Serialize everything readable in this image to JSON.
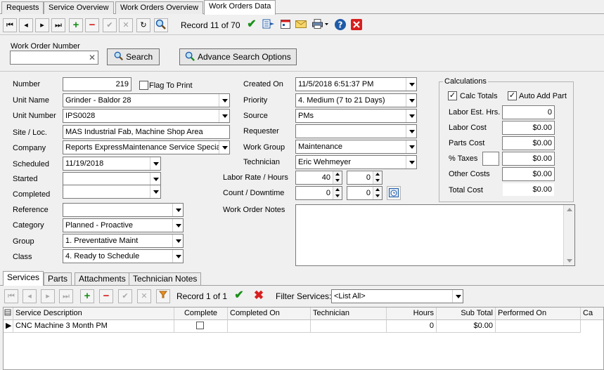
{
  "tabs": [
    "Requests",
    "Service Overview",
    "Work Orders Overview",
    "Work Orders Data"
  ],
  "toolbar": {
    "record_text": "Record 11 of 70"
  },
  "search": {
    "label": "Work Order Number",
    "value": "",
    "search_button": "Search",
    "advance_button": "Advance Search Options"
  },
  "form": {
    "number_label": "Number",
    "number_value": "219",
    "flag_label": "Flag To Print",
    "unit_name_label": "Unit Name",
    "unit_name_value": "Grinder - Baldor 28",
    "unit_number_label": "Unit Number",
    "unit_number_value": "IPS0028",
    "site_label": "Site / Loc.",
    "site_value": "MAS Industrial Fab, Machine Shop Area",
    "company_label": "Company",
    "company_value": "Reports  ExpressMaintenance Service Speciali",
    "scheduled_label": "Scheduled",
    "scheduled_value": "11/19/2018",
    "started_label": "Started",
    "started_value": "",
    "completed_label": "Completed",
    "completed_value": "",
    "reference_label": "Reference",
    "reference_value": "",
    "category_label": "Category",
    "category_value": "Planned - Proactive",
    "group_label": "Group",
    "group_value": "1. Preventative Maint",
    "class_label": "Class",
    "class_value": "4. Ready to Schedule",
    "created_label": "Created On",
    "created_value": "11/5/2018 6:51:37 PM",
    "priority_label": "Priority",
    "priority_value": "4. Medium (7 to 21 Days)",
    "source_label": "Source",
    "source_value": "PMs",
    "requester_label": "Requester",
    "requester_value": "",
    "workgroup_label": "Work Group",
    "workgroup_value": "Maintenance",
    "technician_label": "Technician",
    "technician_value": "Eric Wehmeyer",
    "labor_rate_label": "Labor Rate / Hours",
    "labor_rate_value": "40",
    "labor_hours_value": "0",
    "count_label": "Count / Downtime",
    "count_value": "0",
    "downtime_value": "0",
    "notes_label": "Work Order Notes",
    "notes_value": ""
  },
  "calc": {
    "title": "Calculations",
    "calc_totals_label": "Calc Totals",
    "auto_add_label": "Auto Add Part",
    "labor_est_label": "Labor Est. Hrs.",
    "labor_est_value": "0",
    "labor_cost_label": "Labor Cost",
    "labor_cost_value": "$0.00",
    "parts_cost_label": "Parts Cost",
    "parts_cost_value": "$0.00",
    "taxes_label": "% Taxes",
    "taxes_pct_value": "",
    "taxes_value": "$0.00",
    "other_label": "Other Costs",
    "other_value": "$0.00",
    "total_label": "Total Cost",
    "total_value": "$0.00"
  },
  "bottom_tabs": [
    "Services",
    "Parts",
    "Attachments",
    "Technician Notes"
  ],
  "services_toolbar": {
    "record_text": "Record 1 of 1",
    "filter_label": "Filter Services:",
    "filter_value": "<List All>"
  },
  "grid": {
    "columns": [
      "Service Description",
      "Complete",
      "Completed On",
      "Technician",
      "Hours",
      "Sub Total",
      "Performed On",
      "Ca"
    ],
    "rows": [
      {
        "description": "CNC Machine 3 Month PM",
        "completed_on": "",
        "technician": "",
        "hours": "0",
        "sub_total": "$0.00",
        "performed_on": ""
      }
    ]
  },
  "colors": {
    "green": "#1a8f1a",
    "red": "#d81e1e",
    "blue": "#1e5aa8"
  }
}
